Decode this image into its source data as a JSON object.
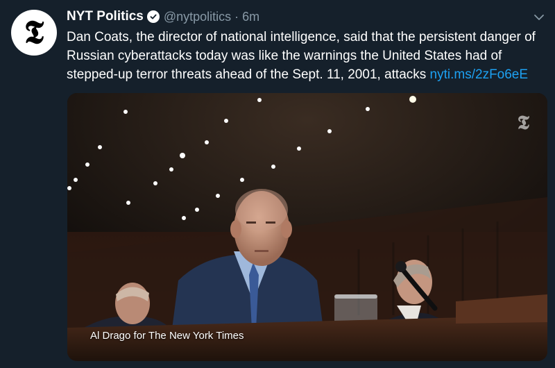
{
  "tweet": {
    "avatar_glyph": "𝕿",
    "display_name": "NYT Politics",
    "handle": "@nytpolitics",
    "separator": "·",
    "time": "6m",
    "text": "Dan Coats, the director of national intelligence, said that the persistent danger of Russian cyberattacks today was like the warnings the United States had of stepped-up terror threats ahead of the Sept. 11, 2001, attacks",
    "link": "nyti.ms/2zFo6eE",
    "icons": {
      "verified": "verified-badge-icon",
      "menu": "chevron-down-icon"
    }
  },
  "media": {
    "watermark": "𝕿",
    "credit": "Al Drago for The New York Times"
  },
  "colors": {
    "background": "#15202b",
    "text": "#ffffff",
    "muted": "#8899a6",
    "link": "#1da1f2"
  }
}
